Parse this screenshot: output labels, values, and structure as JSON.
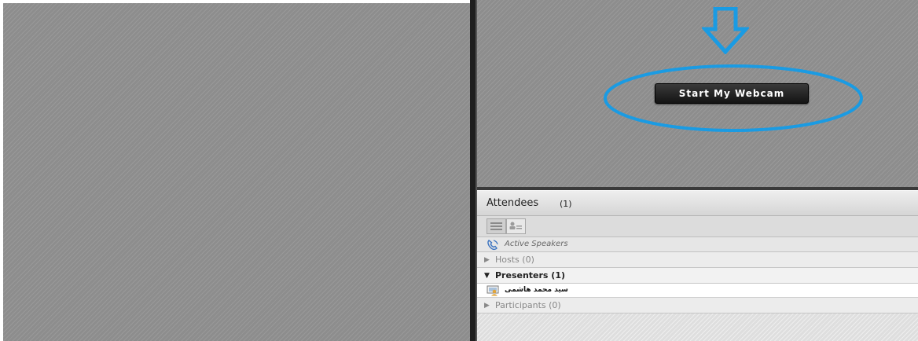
{
  "video_pod": {
    "start_webcam_label": "Start My Webcam",
    "annotation_color": "#1a9be3"
  },
  "attendees": {
    "title": "Attendees",
    "count": "(1)",
    "active_speakers_label": "Active Speakers",
    "groups": [
      {
        "label": "Hosts (0)",
        "expanded": false
      },
      {
        "label": "Presenters (1)",
        "expanded": true,
        "members": [
          "سید محمد هاشمی"
        ]
      },
      {
        "label": "Participants (0)",
        "expanded": false
      }
    ]
  },
  "icons": {
    "arrow": "down-arrow-icon",
    "view_list": "list-view-icon",
    "view_grid": "user-list-view-icon",
    "phone": "phone-icon",
    "presenter": "presenter-icon",
    "expand": "triangle-right-icon",
    "collapse": "triangle-down-icon"
  }
}
